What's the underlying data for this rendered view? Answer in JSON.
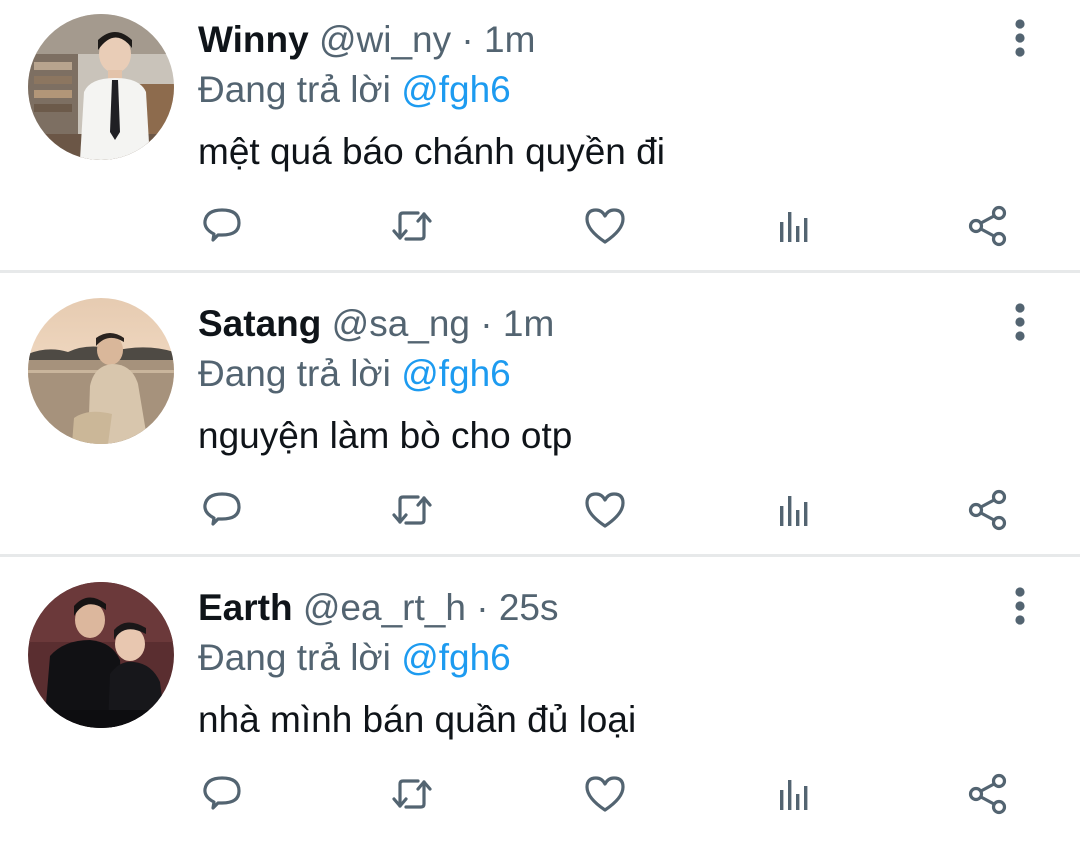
{
  "tweets": [
    {
      "name": "Winny",
      "handle": "@wi_ny",
      "separator": "·",
      "time": "1m",
      "reply_prefix": "Đang trả lời",
      "reply_to": "@fgh6",
      "text": "mệt quá báo chánh quyền đi"
    },
    {
      "name": "Satang",
      "handle": "@sa_ng",
      "separator": "·",
      "time": "1m",
      "reply_prefix": "Đang trả lời",
      "reply_to": "@fgh6",
      "text": "nguyện làm bò cho otp"
    },
    {
      "name": "Earth",
      "handle": "@ea_rt_h",
      "separator": "·",
      "time": "25s",
      "reply_prefix": "Đang trả lời",
      "reply_to": "@fgh6",
      "text": "nhà mình bán quần đủ loại"
    }
  ],
  "icons": {
    "more": "more-vertical-icon",
    "reply": "reply-icon",
    "retweet": "retweet-icon",
    "like": "heart-icon",
    "stats": "analytics-icon",
    "share": "share-icon"
  },
  "colors": {
    "text_primary": "#0f1419",
    "text_secondary": "#536471",
    "mention": "#1d9bf0",
    "divider": "#e7e9ea"
  }
}
